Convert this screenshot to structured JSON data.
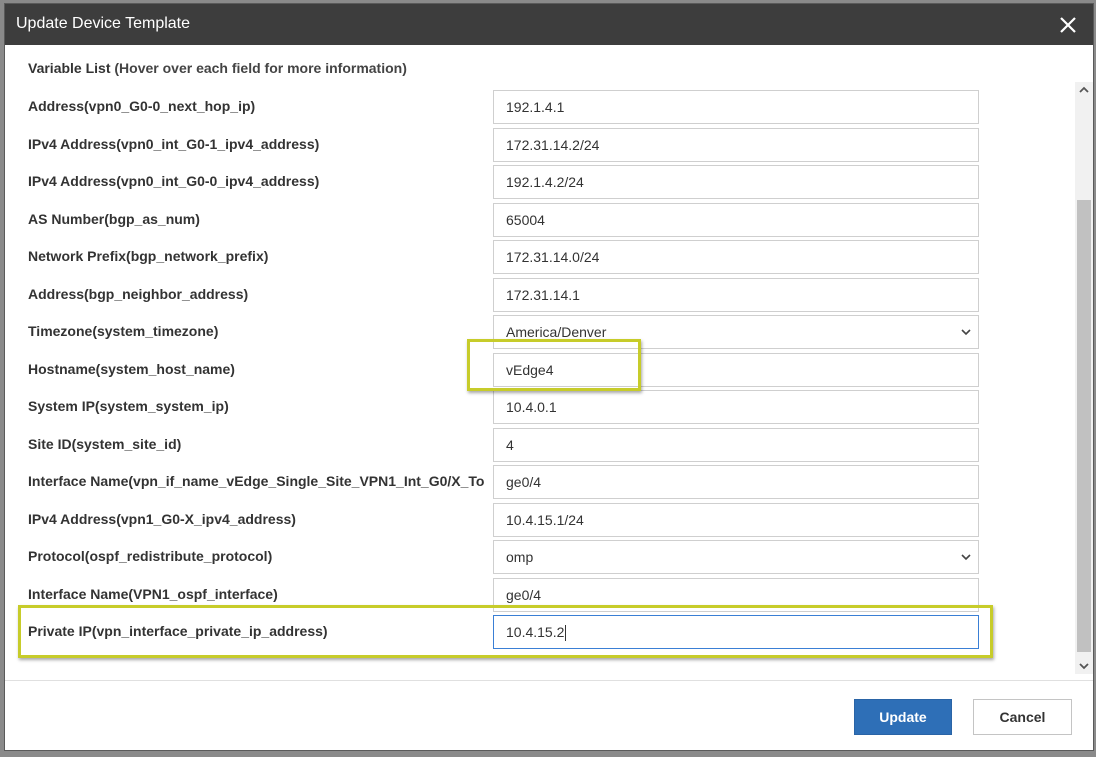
{
  "dialog": {
    "title": "Update Device Template",
    "close_icon": "close-icon"
  },
  "variable_list": {
    "heading": "Variable List",
    "hint": "(Hover over each field for more information)"
  },
  "rows": [
    {
      "label": "Address(vpn0_G0-0_next_hop_ip)",
      "value": "192.1.4.1",
      "type": "text"
    },
    {
      "label": "IPv4 Address(vpn0_int_G0-1_ipv4_address)",
      "value": "172.31.14.2/24",
      "type": "text"
    },
    {
      "label": "IPv4 Address(vpn0_int_G0-0_ipv4_address)",
      "value": "192.1.4.2/24",
      "type": "text"
    },
    {
      "label": "AS Number(bgp_as_num)",
      "value": "65004",
      "type": "text"
    },
    {
      "label": "Network Prefix(bgp_network_prefix)",
      "value": "172.31.14.0/24",
      "type": "text"
    },
    {
      "label": "Address(bgp_neighbor_address)",
      "value": "172.31.14.1",
      "type": "text"
    },
    {
      "label": "Timezone(system_timezone)",
      "value": "America/Denver",
      "type": "select"
    },
    {
      "label": "Hostname(system_host_name)",
      "value": "vEdge4",
      "type": "text"
    },
    {
      "label": "System IP(system_system_ip)",
      "value": "10.4.0.1",
      "type": "text"
    },
    {
      "label": "Site ID(system_site_id)",
      "value": "4",
      "type": "text"
    },
    {
      "label": "Interface Name(vpn_if_name_vEdge_Single_Site_VPN1_Int_G0/X_To",
      "value": "ge0/4",
      "type": "text"
    },
    {
      "label": "IPv4 Address(vpn1_G0-X_ipv4_address)",
      "value": "10.4.15.1/24",
      "type": "text"
    },
    {
      "label": "Protocol(ospf_redistribute_protocol)",
      "value": "omp",
      "type": "select"
    },
    {
      "label": "Interface Name(VPN1_ospf_interface)",
      "value": "ge0/4",
      "type": "text"
    },
    {
      "label": "Private IP(vpn_interface_private_ip_address)",
      "value": "10.4.15.2",
      "type": "text",
      "focused": true
    }
  ],
  "footer": {
    "update_label": "Update",
    "cancel_label": "Cancel"
  },
  "colors": {
    "titlebar": "#3d3d3d",
    "primary_button": "#2e6fb7",
    "highlight": "#c7cc2a"
  }
}
